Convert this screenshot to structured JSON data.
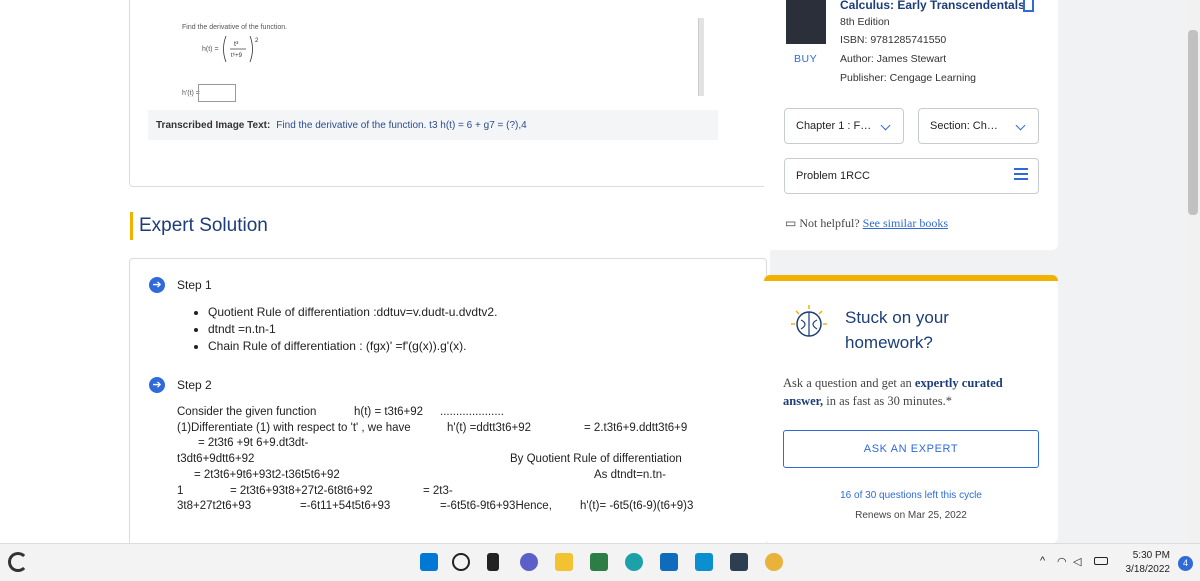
{
  "question": {
    "image_prompt": "Find the derivative of the function.",
    "image_ht": "h(t) =",
    "image_hp": "h'(t) =",
    "transcribed_label": "Transcribed Image Text:",
    "transcribed_text": "Find the derivative of the function. t3 h(t) = 6 + g7 = (?),4"
  },
  "expert_solution_title": "Expert Solution",
  "step1": {
    "title": "Step 1",
    "bullets": [
      "Quotient Rule of differentiation :ddtuv=v.dudt-u.dvdtv2.",
      "dtndt =n.tn-1",
      "Chain Rule of differentiation : (fgx)' =f'(g(x)).g'(x)."
    ]
  },
  "step2": {
    "title": "Step 2",
    "lines": {
      "a1": "Consider the given function",
      "a2": "h(t) = t3t6+92",
      "a3": "....................",
      "b1": "(1)Differentiate (1) with respect to 't' , we have",
      "b2": "h'(t) =ddtt3t6+92",
      "b3": "= 2.t3t6+9.ddtt3t6+9",
      "c1": "= 2t3t6 +9t 6+9.dt3dt-",
      "d1": "t3dt6+9dtt6+92",
      "d2": "By Quotient Rule of differentiation",
      "e1": "= 2t3t6+9t6+93t2-t36t5t6+92",
      "e2": "As dtndt=n.tn-",
      "f1": "1",
      "f2": "= 2t3t6+93t8+27t2-6t8t6+92",
      "f3": "= 2t3-",
      "g1": "3t8+27t2t6+93",
      "g2": "=-6t11+54t5t6+93",
      "g3": "=-6t5t6-9t6+93Hence,",
      "g4": "h'(t)= -6t5(t6-9)(t6+9)3"
    }
  },
  "book": {
    "title": "Calculus: Early Transcendentals",
    "edition": "8th Edition",
    "isbn": "ISBN: 9781285741550",
    "author": "Author: James Stewart",
    "publisher": "Publisher: Cengage Learning",
    "buy": "BUY",
    "chapter_select": "Chapter 1 : F…",
    "section_select": "Section: Ch…",
    "problem_select": "Problem 1RCC",
    "not_helpful": "Not helpful?",
    "similar_books": "See similar books"
  },
  "stuck": {
    "title": "Stuck on your\nhomework?",
    "desc_a": "Ask a question and get an ",
    "desc_b": "expertly curated answer,",
    "desc_c": " in as fast as 30 minutes.*",
    "button": "ASK AN EXPERT",
    "questions_left": "16 of 30 questions left this cycle",
    "renews": "Renews on Mar 25, 2022"
  },
  "taskbar": {
    "time": "5:30 PM",
    "date": "3/18/2022",
    "notifications": "4"
  },
  "colors": {
    "accent": "#2f6ad8",
    "brand_navy": "#1c3d78",
    "highlight": "#f2b100"
  }
}
